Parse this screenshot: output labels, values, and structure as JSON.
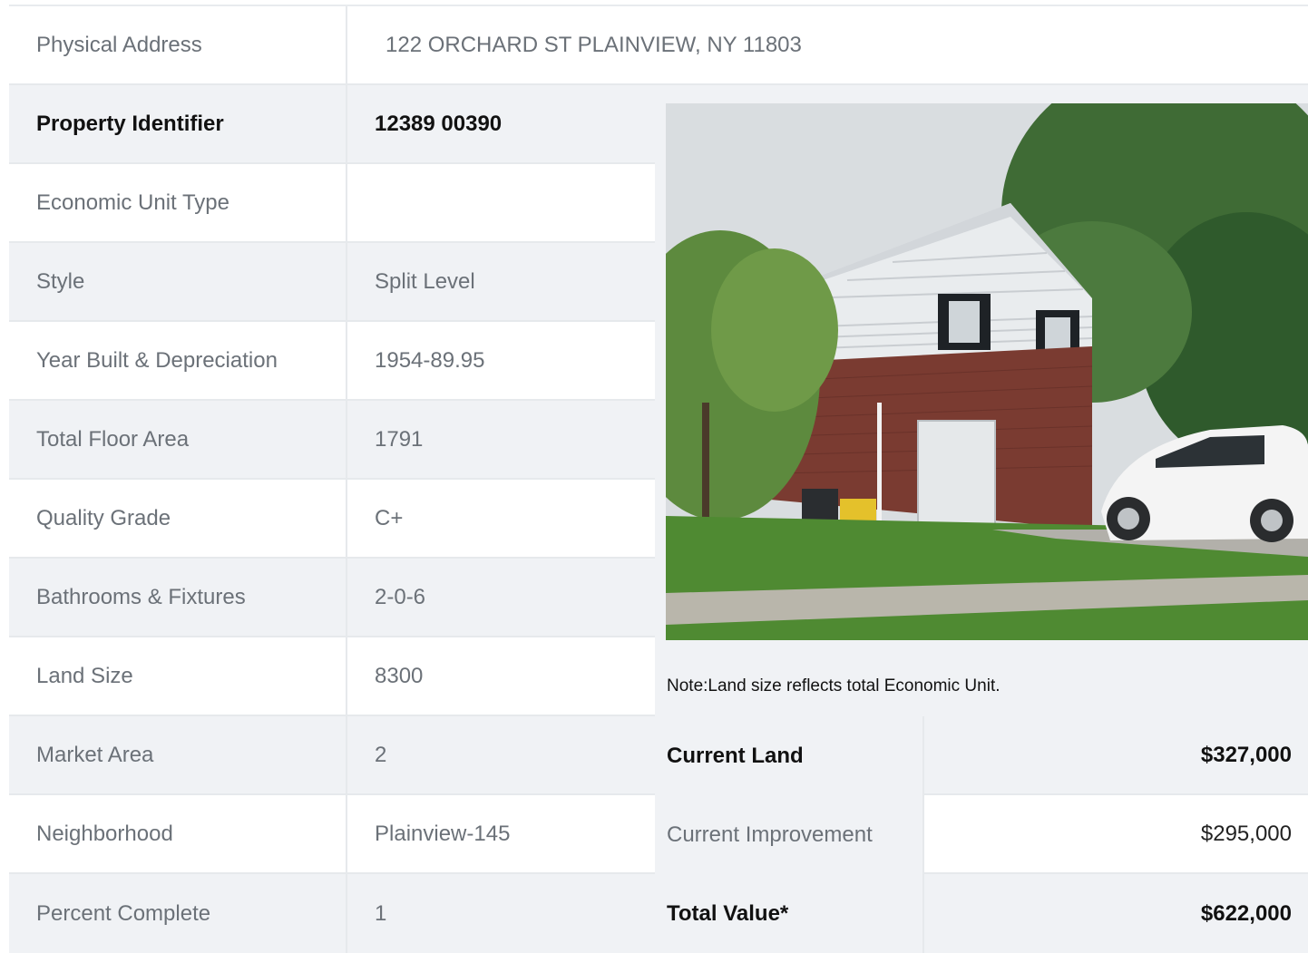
{
  "property": {
    "address_label": "Physical Address",
    "address_value": "122  ORCHARD ST  PLAINVIEW, NY  11803",
    "rows": [
      {
        "label": "Property Identifier",
        "value": "12389  00390"
      },
      {
        "label": "Economic Unit Type",
        "value": ""
      },
      {
        "label": "Style",
        "value": "Split Level"
      },
      {
        "label": "Year Built & Depreciation",
        "value": "1954-89.95"
      },
      {
        "label": "Total Floor Area",
        "value": "1791"
      },
      {
        "label": "Quality Grade",
        "value": "C+"
      },
      {
        "label": "Bathrooms & Fixtures",
        "value": "2-0-6"
      },
      {
        "label": "Land Size",
        "value": "8300"
      },
      {
        "label": "Market Area",
        "value": "2"
      },
      {
        "label": "Neighborhood",
        "value": "Plainview-145"
      },
      {
        "label": "Percent Complete",
        "value": "1"
      }
    ]
  },
  "note": "Note:Land size reflects total Economic Unit.",
  "valuation": {
    "current_land_label": "Current Land",
    "current_land_value": "$327,000",
    "current_improvement_label": "Current Improvement",
    "current_improvement_value": "$295,000",
    "total_label": "Total Value*",
    "total_value": "$622,000"
  },
  "photo": {
    "subject": "house-photo"
  }
}
